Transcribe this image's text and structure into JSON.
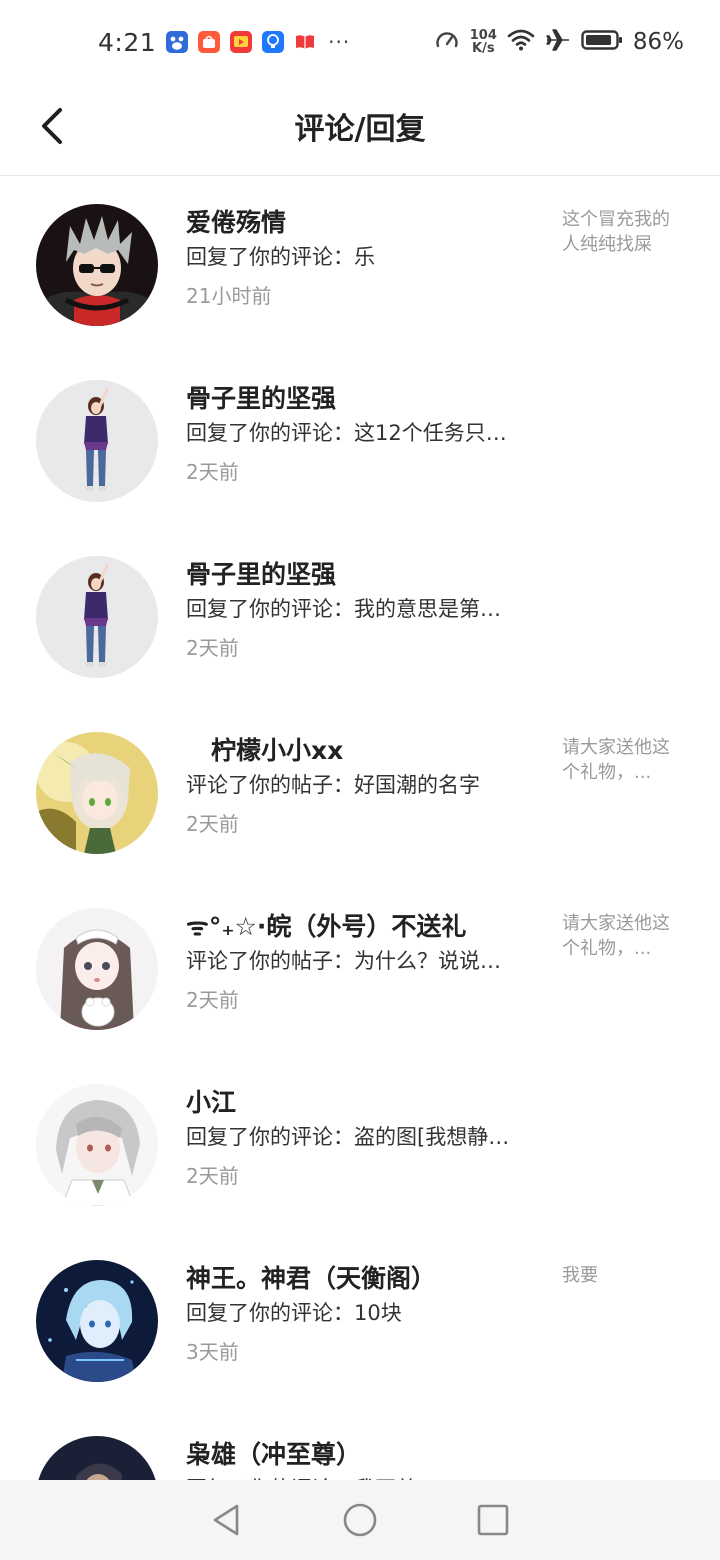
{
  "status_bar": {
    "time": "4:21",
    "net_speed_value": "104",
    "net_speed_unit": "K/s",
    "battery": "86%",
    "more": "···"
  },
  "header": {
    "title": "评论/回复"
  },
  "items": [
    {
      "name": "爱倦殇情",
      "excerpt": "回复了你的评论：乐",
      "time": "21小时前",
      "origin": "这个冒充我的人纯纯找屎"
    },
    {
      "name": "骨子里的坚强",
      "excerpt": "回复了你的评论：这12个任务只…",
      "time": "2天前",
      "origin": ""
    },
    {
      "name": "骨子里的坚强",
      "excerpt": "回复了你的评论：我的意思是第…",
      "time": "2天前",
      "origin": ""
    },
    {
      "name": "　柠檬小小xx",
      "excerpt": "评论了你的帖子：好国潮的名字",
      "time": "2天前",
      "origin": "请大家送他这个礼物，..."
    },
    {
      "name": "ᯤ°₊☆·皖（外号）不送礼",
      "excerpt": "评论了你的帖子：为什么？说说…",
      "time": "2天前",
      "origin": "请大家送他这个礼物，..."
    },
    {
      "name": "小江",
      "excerpt": "回复了你的评论：盗的图[我想静…",
      "time": "2天前",
      "origin": ""
    },
    {
      "name": "神王。神君（天衡阁）",
      "excerpt": "回复了你的评论：10块",
      "time": "3天前",
      "origin": "我要"
    },
    {
      "name": "枭雄（冲至尊）",
      "excerpt": "回复了你的评论：我不尊…",
      "time": "",
      "origin": ""
    }
  ],
  "icons": {
    "back": "back-arrow-icon",
    "nav_back": "triangle-back-icon",
    "nav_home": "circle-home-icon",
    "nav_recent": "square-recent-icon"
  },
  "colors": {
    "text_primary": "#222222",
    "text_secondary": "#9a9a9a",
    "divider": "#e6e6e6",
    "nav_bg": "#f5f5f5"
  }
}
